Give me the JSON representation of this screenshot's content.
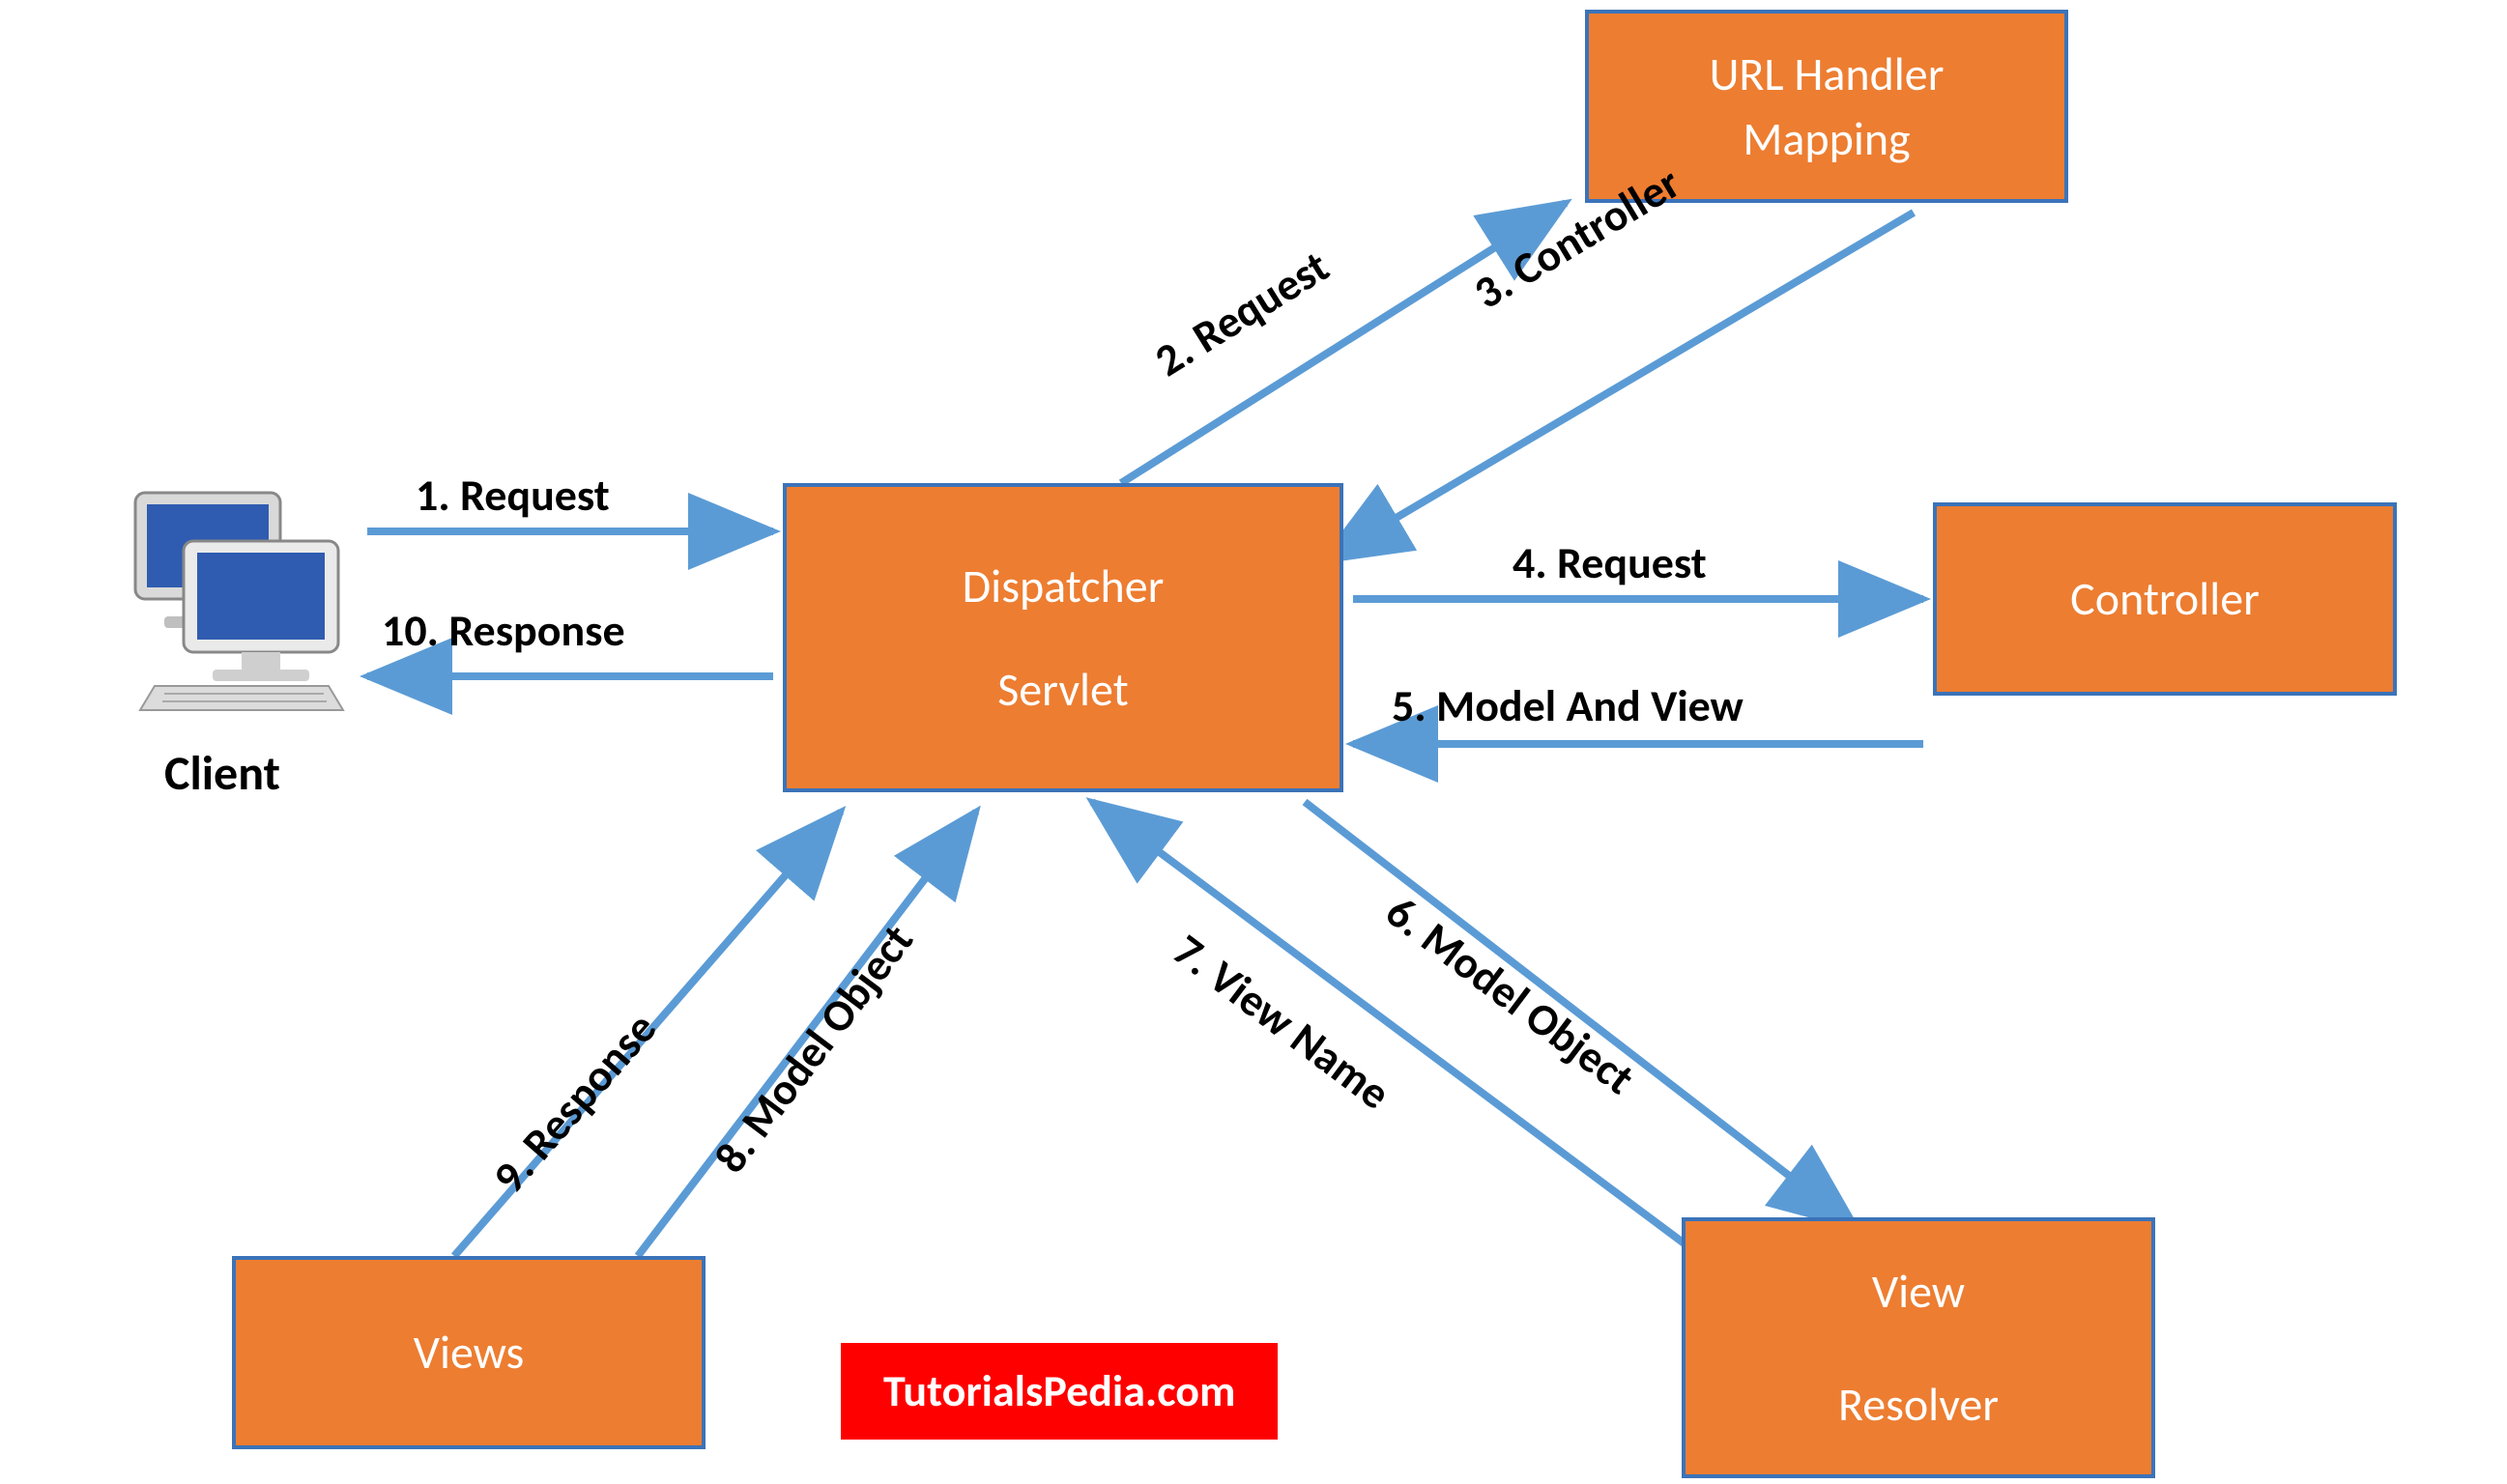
{
  "nodes": {
    "dispatcher": {
      "line1": "Dispatcher",
      "line2": "Servlet"
    },
    "url_handler": {
      "line1": "URL Handler",
      "line2": "Mapping"
    },
    "controller": {
      "line1": "Controller"
    },
    "view_resolver": {
      "line1": "View",
      "line2": "Resolver"
    },
    "views": {
      "line1": "Views"
    },
    "client": {
      "label": "Client"
    }
  },
  "edges": {
    "e1": "1. Request",
    "e2": "2. Request",
    "e3": "3. Controller",
    "e4": "4. Request",
    "e5": "5. Model And View",
    "e6": "6. Model Object",
    "e7": "7. View Name",
    "e8": "8. Model Object",
    "e9": "9. Response",
    "e10": "10. Response"
  },
  "watermark": "TutorialsPedia.com",
  "colors": {
    "box_fill": "#ED7D31",
    "box_border": "#3B73B9",
    "arrow": "#5B9BD5",
    "watermark_bg": "#FF0000"
  }
}
